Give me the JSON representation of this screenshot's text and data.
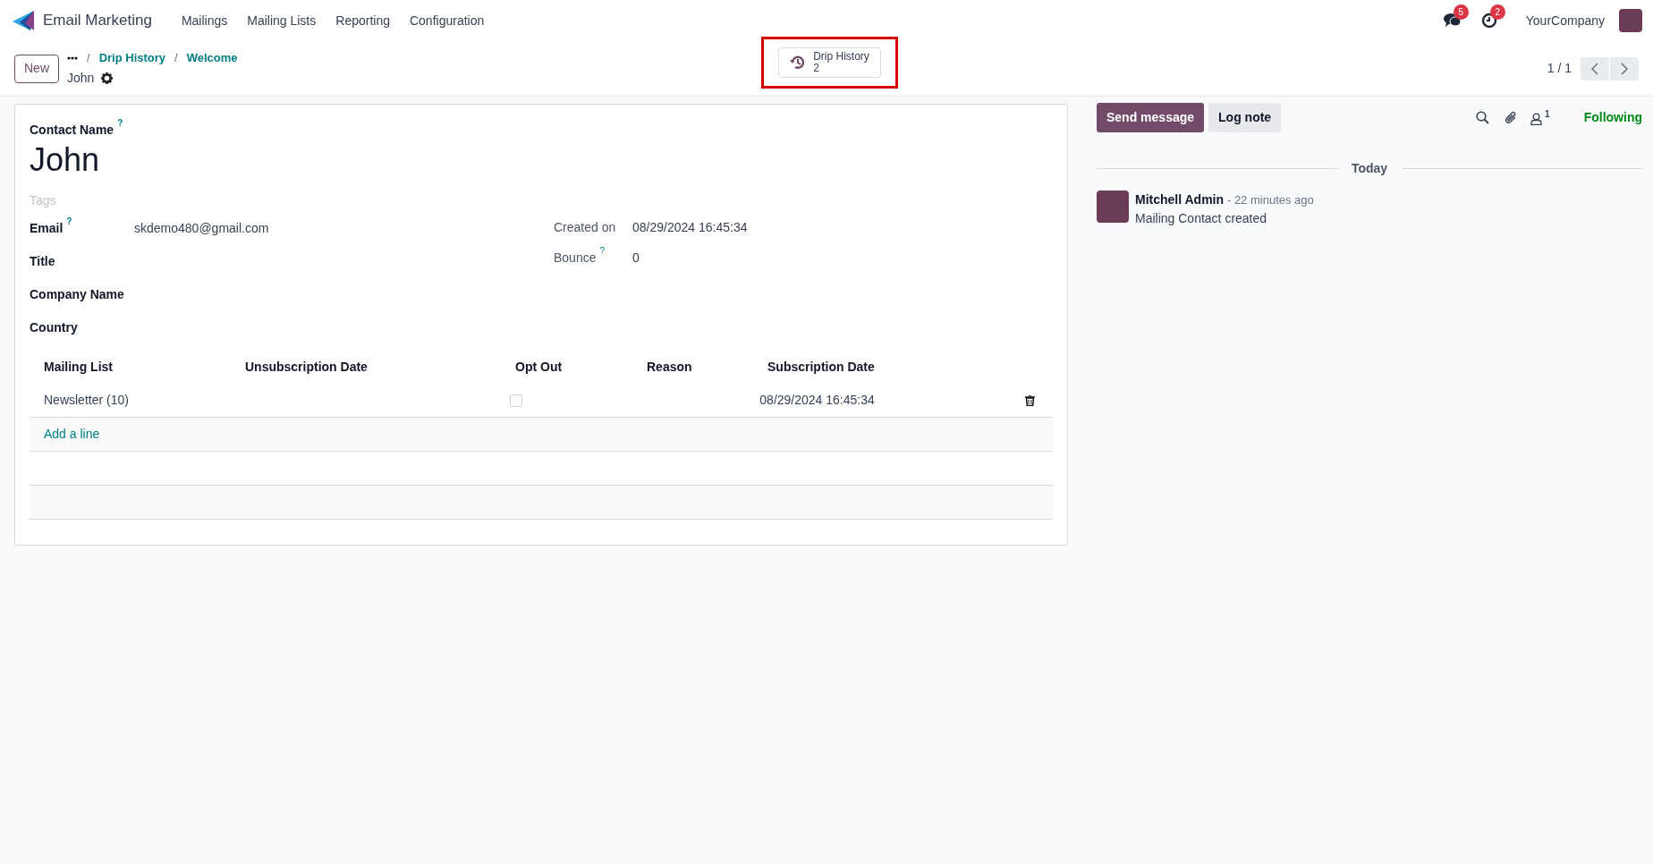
{
  "navbar": {
    "app_name": "Email Marketing",
    "menu": [
      "Mailings",
      "Mailing Lists",
      "Reporting",
      "Configuration"
    ],
    "messages_badge": "5",
    "activities_badge": "2",
    "company": "YourCompany"
  },
  "control_panel": {
    "new_button": "New",
    "breadcrumb_separator": "/",
    "breadcrumbs": [
      "Drip History",
      "Welcome"
    ],
    "record_name": "John",
    "smart_button": {
      "label": "Drip History",
      "count": "2",
      "highlighted": true
    },
    "pager": "1 / 1"
  },
  "form": {
    "contact_name_label": "Contact Name",
    "contact_name_help": "?",
    "name": "John",
    "tags_placeholder": "Tags",
    "left_fields": [
      {
        "label": "Email",
        "help": "?",
        "value": "skdemo480@gmail.com"
      },
      {
        "label": "Title"
      },
      {
        "label": "Company Name"
      },
      {
        "label": "Country"
      }
    ],
    "right_fields": [
      {
        "label": "Created on",
        "value": "08/29/2024 16:45:34"
      },
      {
        "label": "Bounce",
        "help": "?",
        "value": "0"
      }
    ],
    "table": {
      "columns": [
        "Mailing List",
        "Unsubscription Date",
        "Opt Out",
        "Reason",
        "Subscription Date"
      ],
      "rows": [
        {
          "mailing_list": "Newsletter (10)",
          "opt_out": false,
          "subscription_date": "08/29/2024 16:45:34"
        }
      ],
      "add_line": "Add a line"
    }
  },
  "chatter": {
    "send_message": "Send message",
    "log_note": "Log note",
    "followers_count": "1",
    "following": "Following",
    "date_separator": "Today",
    "messages": [
      {
        "author": "Mitchell Admin",
        "time": "- 22 minutes ago",
        "body": "Mailing Contact created"
      }
    ]
  }
}
